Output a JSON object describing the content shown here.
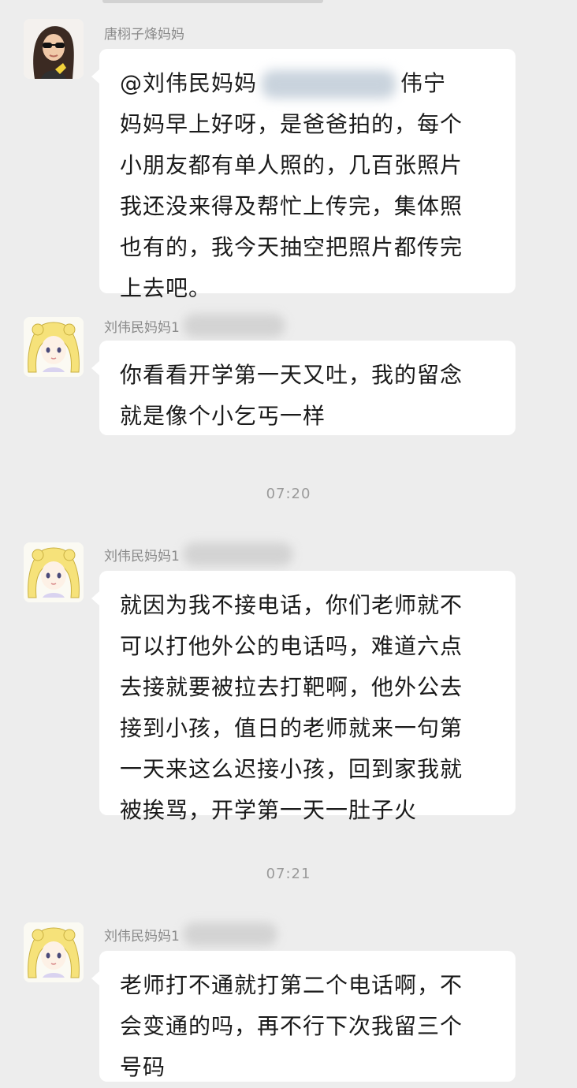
{
  "messages": [
    {
      "sender": "唐栩子烽妈妈",
      "avatar": "woman-sunglasses-avatar",
      "mention": "@刘伟民妈妈",
      "lines": [
        "伟宁",
        "妈妈早上好呀，是爸爸拍的，每个",
        "小朋友都有单人照的，几百张照片",
        "我还没来得及帮忙上传完，集体照",
        "也有的，我今天抽空把照片都传完",
        "上去吧。"
      ]
    },
    {
      "sender": "刘伟民妈妈1",
      "avatar": "anime-girl-avatar",
      "lines": [
        "你看看开学第一天又吐，我的留念",
        "就是像个小乞丐一样"
      ]
    },
    {
      "sender": "刘伟民妈妈1",
      "avatar": "anime-girl-avatar",
      "lines": [
        "就因为我不接电话，你们老师就不",
        "可以打他外公的电话吗，难道六点",
        "去接就要被拉去打靶啊，他外公去",
        "接到小孩，值日的老师就来一句第",
        "一天来这么迟接小孩，回到家我就",
        "被挨骂，开学第一天一肚子火"
      ]
    },
    {
      "sender": "刘伟民妈妈1",
      "avatar": "anime-girl-avatar",
      "lines": [
        "老师打不通就打第二个电话啊，不",
        "会变通的吗，再不行下次我留三个",
        "号码"
      ]
    }
  ],
  "timestamps": [
    "07:20",
    "07:21"
  ],
  "colors": {
    "background": "#ededed",
    "bubble": "#ffffff",
    "name": "#8a8a8a",
    "timestamp": "#9a9a9a",
    "text": "#1a1a1a"
  }
}
